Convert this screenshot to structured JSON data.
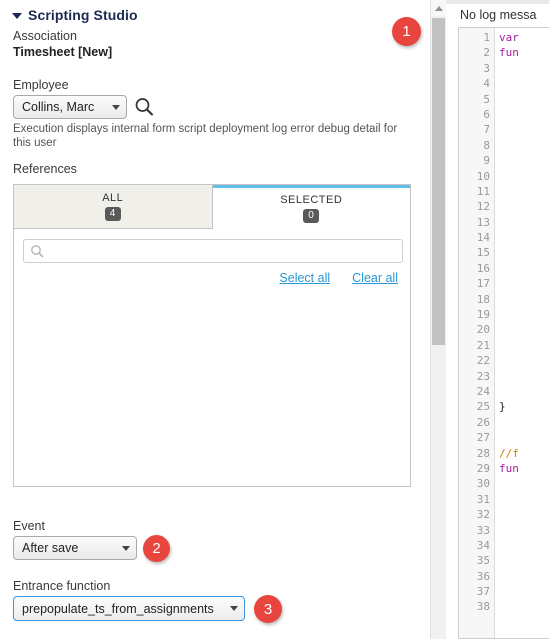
{
  "panel": {
    "title": "Scripting Studio",
    "collapse_icon": "caret-down-icon"
  },
  "association": {
    "label": "Association",
    "value": "Timesheet [New]"
  },
  "employee": {
    "label": "Employee",
    "selected": "Collins, Marc",
    "search_icon": "magnifier-icon"
  },
  "help_text": "Execution displays internal form script deployment log error debug detail for this user",
  "references": {
    "label": "References",
    "tabs": [
      {
        "label": "ALL",
        "count": "4",
        "active": false
      },
      {
        "label": "SELECTED",
        "count": "0",
        "active": true
      }
    ],
    "search_placeholder": "",
    "search_value": "",
    "search_icon": "search-icon",
    "select_all_link": "Select all",
    "clear_all_link": "Clear all"
  },
  "event": {
    "label": "Event",
    "selected": "After save"
  },
  "entrance_function": {
    "label": "Entrance function",
    "selected": "prepopulate_ts_from_assignments"
  },
  "step_badges": [
    {
      "number": "1"
    },
    {
      "number": "2"
    },
    {
      "number": "3"
    }
  ],
  "scrollbar": {
    "up_arrow_icon": "caret-up-icon"
  },
  "log": {
    "message": "No log messa"
  },
  "editor": {
    "line_numbers": [
      "1",
      "2",
      "3",
      "4",
      "5",
      "6",
      "7",
      "8",
      "9",
      "10",
      "11",
      "12",
      "13",
      "14",
      "15",
      "16",
      "17",
      "18",
      "19",
      "20",
      "21",
      "22",
      "23",
      "24",
      "25",
      "26",
      "27",
      "28",
      "29",
      "30",
      "31",
      "32",
      "33",
      "34",
      "35",
      "36",
      "37",
      "38"
    ],
    "lines": [
      {
        "text": "var",
        "type": "keyword"
      },
      {
        "text": "fun",
        "type": "keyword"
      },
      {
        "text": "",
        "type": "plain"
      },
      {
        "text": "",
        "type": "plain"
      },
      {
        "text": "",
        "type": "plain"
      },
      {
        "text": "",
        "type": "plain"
      },
      {
        "text": "",
        "type": "plain"
      },
      {
        "text": "",
        "type": "plain"
      },
      {
        "text": "",
        "type": "plain"
      },
      {
        "text": "",
        "type": "plain"
      },
      {
        "text": "",
        "type": "plain"
      },
      {
        "text": "",
        "type": "plain"
      },
      {
        "text": "",
        "type": "plain"
      },
      {
        "text": "",
        "type": "plain"
      },
      {
        "text": "",
        "type": "plain"
      },
      {
        "text": "",
        "type": "plain"
      },
      {
        "text": "",
        "type": "plain"
      },
      {
        "text": "",
        "type": "plain"
      },
      {
        "text": "",
        "type": "plain"
      },
      {
        "text": "",
        "type": "plain"
      },
      {
        "text": "",
        "type": "plain"
      },
      {
        "text": "",
        "type": "plain"
      },
      {
        "text": "",
        "type": "plain"
      },
      {
        "text": "",
        "type": "plain"
      },
      {
        "text": "}",
        "type": "plain"
      },
      {
        "text": "",
        "type": "plain"
      },
      {
        "text": "",
        "type": "plain"
      },
      {
        "text": "//f",
        "type": "comment"
      },
      {
        "text": "fun",
        "type": "keyword"
      },
      {
        "text": "",
        "type": "plain"
      },
      {
        "text": "",
        "type": "plain"
      },
      {
        "text": "",
        "type": "plain"
      },
      {
        "text": "",
        "type": "plain"
      },
      {
        "text": "",
        "type": "plain"
      },
      {
        "text": "",
        "type": "plain"
      },
      {
        "text": "",
        "type": "plain"
      },
      {
        "text": "",
        "type": "plain"
      },
      {
        "text": "",
        "type": "plain"
      }
    ]
  },
  "colors": {
    "badge_red": "#e8453e",
    "link_blue": "#2a96d4",
    "tab_active_border": "#63bde4",
    "focus_blue": "#3b93d8",
    "title_navy": "#1b2a52"
  }
}
